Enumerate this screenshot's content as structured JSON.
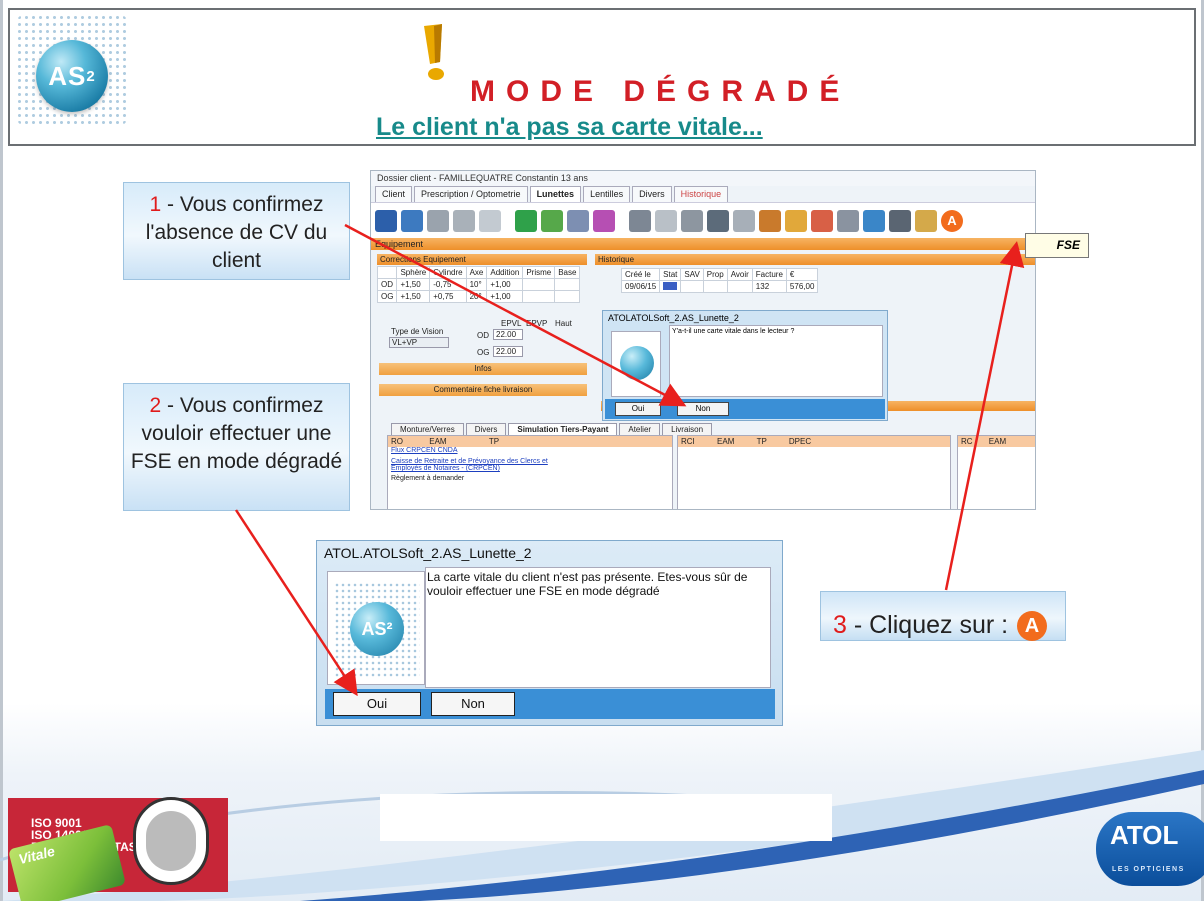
{
  "header": {
    "logo_text": "AS",
    "logo_sup": "2",
    "title": "MODE DÉGRADÉ",
    "subtitle": "Le client n'a pas sa carte vitale..."
  },
  "callouts": {
    "step1_num": "1",
    "step1_text": " - Vous confirmez l'absence de CV du client",
    "step2_num": "2",
    "step2_text": " - Vous confirmez vouloir effectuer une FSE en mode dégradé",
    "step3_num": "3",
    "step3_text": " - Cliquez sur : ",
    "step3_badge": "A"
  },
  "app": {
    "window_title": "Dossier client - FAMILLEQUATRE Constantin 13 ans",
    "tabs": [
      {
        "label": "Client"
      },
      {
        "label": "Prescription / Optometrie"
      },
      {
        "label": "Lunettes"
      },
      {
        "label": "Lentilles"
      },
      {
        "label": "Divers"
      },
      {
        "label": "Historique"
      }
    ],
    "toolbar_a": "A",
    "equipement_label": "Equipement",
    "corrections_head": "Corrections Equipement",
    "corrections_cols": [
      "Sphère",
      "Cylindre",
      "Axe",
      "Addition",
      "Prisme",
      "Base"
    ],
    "corrections_rows": [
      {
        "eye": "OD",
        "values": [
          "+1,50",
          "-0,75",
          "10°",
          "+1,00",
          "",
          ""
        ]
      },
      {
        "eye": "OG",
        "values": [
          "+1,50",
          "+0,75",
          "20°",
          "+1,00",
          "",
          ""
        ]
      }
    ],
    "vision_label": "Type de Vision",
    "vision_value": "VL+VP",
    "ep_cols": [
      "EPVL",
      "EPVP",
      "Haut"
    ],
    "od_label": "OD",
    "od_value": "22.00",
    "og_label": "OG",
    "og_value": "22.00",
    "infos_label": "Infos",
    "commentaire_label": "Commentaire fiche livraison",
    "historique_head": "Historique",
    "historique_cols": [
      "Créé le",
      "Stat",
      "SAV",
      "Prop",
      "Avoir",
      "Facture",
      "€"
    ],
    "historique_row": {
      "date": "09/06/15",
      "facture": "132",
      "amount": "576,00"
    },
    "bottom_tabs": [
      "Monture/Verres",
      "Divers",
      "Simulation Tiers-Payant",
      "Atelier",
      "Livraison"
    ],
    "tiers": {
      "ro_label": "RO",
      "eam_label": "EAM",
      "tp_label": "TP",
      "link1": "Flux CRPCEN CNDA",
      "link2": "Caisse de Retraite et de Prévoyance des Clercs et Employés de Notaires - (CRPCEN)",
      "reglement": "Règlement à demander",
      "rc_cols": [
        "RCI",
        "EAM",
        "TP",
        "DPEC"
      ],
      "rc2_cols": [
        "RC",
        "EAM"
      ]
    }
  },
  "mini_dialog": {
    "title": "ATOLATOLSoft_2.AS_Lunette_2",
    "message": "Y'a-t-il une carte vitale dans le lecteur ?",
    "oui": "Oui",
    "non": "Non"
  },
  "fse_tooltip": "FSE",
  "big_dialog": {
    "title": "ATOL.ATOLSoft_2.AS_Lunette_2",
    "message": "La carte vitale du client n'est pas présente. Etes-vous sûr de vouloir effectuer une FSE en mode dégradé",
    "oui": "Oui",
    "non": "Non",
    "logo_text": "AS²"
  },
  "footer": {
    "cert_lines": [
      "ISO 9001",
      "ISO 14001",
      "BUREAU VERITAS"
    ],
    "vitale_label": "Vitale",
    "atol_logo": "ATOL",
    "atol_sub": "LES OPTICIENS"
  },
  "colors": {
    "title_red": "#d21f26",
    "subtitle_teal": "#178a8a",
    "arrow_red": "#e8201d",
    "accent_orange": "#f26c1d",
    "dialog_blue": "#3a8fd6"
  }
}
